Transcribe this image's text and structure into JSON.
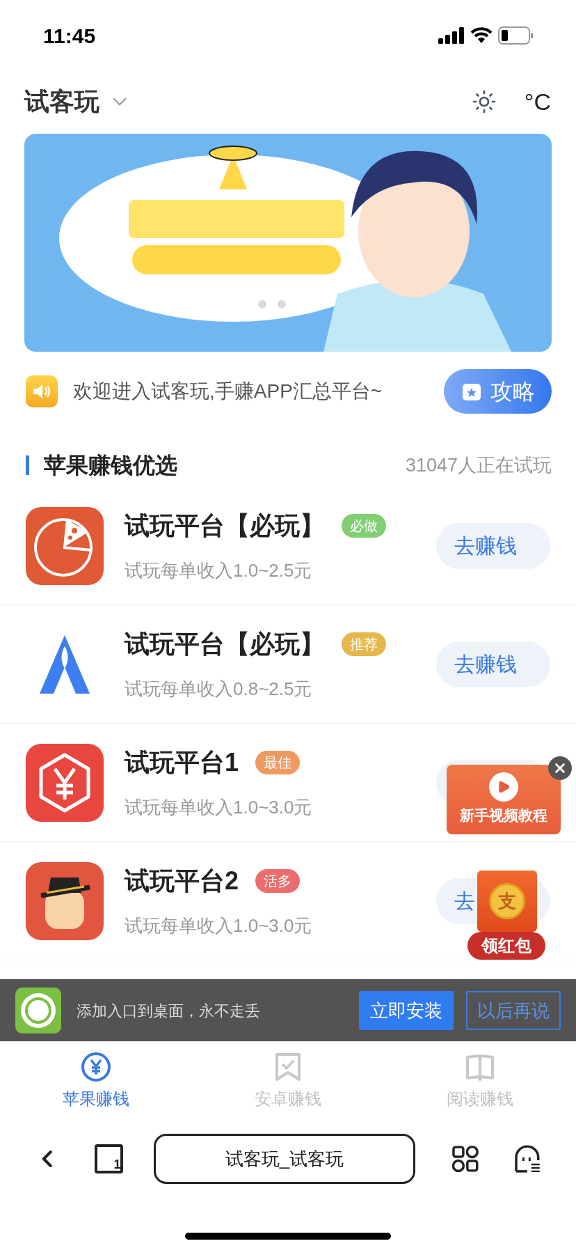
{
  "status_bar": {
    "time": "11:45"
  },
  "header": {
    "title": "试客玩",
    "unit": "°C"
  },
  "notice": {
    "text": "欢迎进入试客玩,手赚APP汇总平台~",
    "button": "攻略"
  },
  "section": {
    "title": "苹果赚钱优选",
    "count": "31047人正在试玩"
  },
  "apps": [
    {
      "name": "试玩平台【必玩】",
      "tag": {
        "text": "必做",
        "color": "#80cf72"
      },
      "subtitle": "试玩每单收入1.0~2.5元",
      "action": "去赚钱"
    },
    {
      "name": "试玩平台【必玩】",
      "tag": {
        "text": "推荐",
        "color": "#e5b74c"
      },
      "subtitle": "试玩每单收入0.8~2.5元",
      "action": "去赚钱"
    },
    {
      "name": "试玩平台1",
      "tag": {
        "text": "最佳",
        "color": "#ee9a60"
      },
      "subtitle": "试玩每单收入1.0~3.0元"
    },
    {
      "name": "试玩平台2",
      "tag": {
        "text": "活多",
        "color": "#ec6d6d"
      },
      "subtitle": "试玩每单收入1.0~3.0元",
      "action": "去"
    }
  ],
  "install_prompt": {
    "text": "添加入口到桌面，永不走丢",
    "buttons": [
      "立即安装",
      "以后再说"
    ]
  },
  "video_tutorial": {
    "label": "新手视频教程"
  },
  "red_envelope": {
    "mark": "支",
    "label": "领红包"
  },
  "tabs": [
    {
      "label": "苹果赚钱",
      "selected": true
    },
    {
      "label": "安卓赚钱",
      "selected": false
    },
    {
      "label": "阅读赚钱",
      "selected": false
    }
  ],
  "browser": {
    "tab_count": "1",
    "address": "试客玩_试客玩"
  }
}
